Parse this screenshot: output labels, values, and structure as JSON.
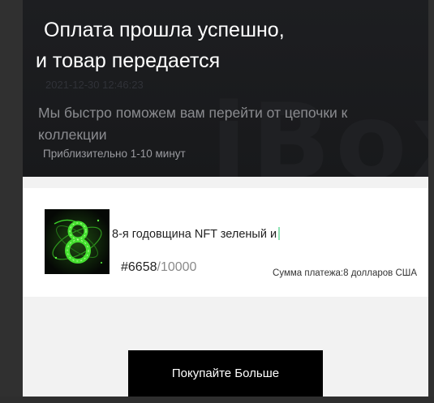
{
  "hero": {
    "title_line1": "Оплата прошла успешно,",
    "title_line2": "и товар передается",
    "timestamp": "2021-12-30 12:46:23",
    "subtitle": "Мы быстро поможем вам перейти от цепочки к коллекции",
    "eta": "Приблизительно 1-10 минут",
    "watermark": "iBox"
  },
  "order": {
    "thumbnail_icon": "nft-figure-eight-image",
    "name": "8-я годовщина NFT зеленый и",
    "number": "#6658",
    "number_total": "/10000",
    "payment": "Сумма платежа:8 долларов США"
  },
  "actions": {
    "buy_more_label": "Покупайте Больше"
  },
  "colors": {
    "hero_bg": "#1a1b1d",
    "content_bg": "#f2f2f2",
    "button_bg": "#000000",
    "nft_green": "#3bd12a"
  }
}
